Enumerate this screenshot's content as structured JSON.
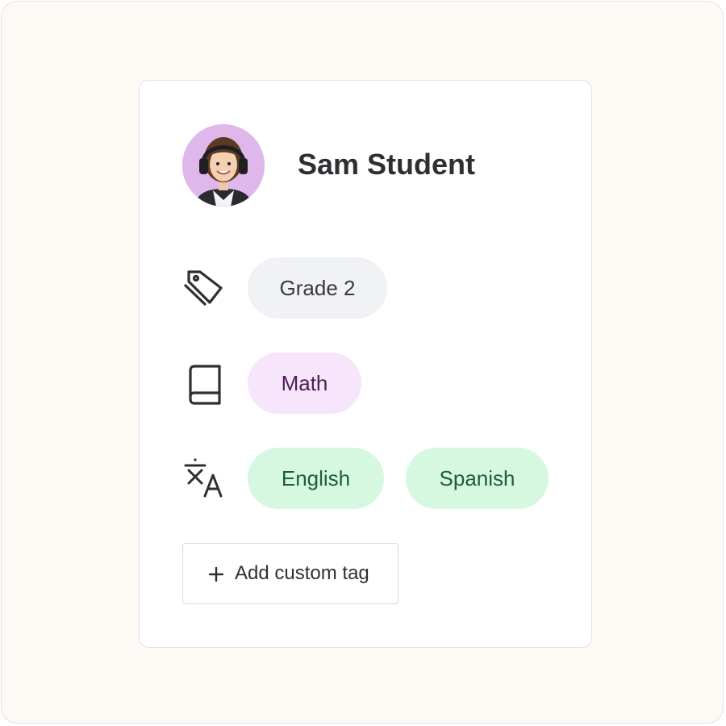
{
  "student": {
    "name": "Sam Student",
    "avatar_bg": "#dfb7ea"
  },
  "tags": {
    "grade": {
      "icon": "tags-icon",
      "items": [
        "Grade 2"
      ]
    },
    "subject": {
      "icon": "book-icon",
      "items": [
        "Math"
      ]
    },
    "language": {
      "icon": "translate-icon",
      "items": [
        "English",
        "Spanish"
      ]
    }
  },
  "add_tag": {
    "icon": "plus-icon",
    "label": "Add custom tag"
  },
  "colors": {
    "grade_chip_bg": "#f1f2f6",
    "subject_chip_bg": "#f6e5fb",
    "subject_chip_text": "#4d1f54",
    "language_chip_bg": "#d6f7e0",
    "language_chip_text": "#1e5e3c"
  }
}
